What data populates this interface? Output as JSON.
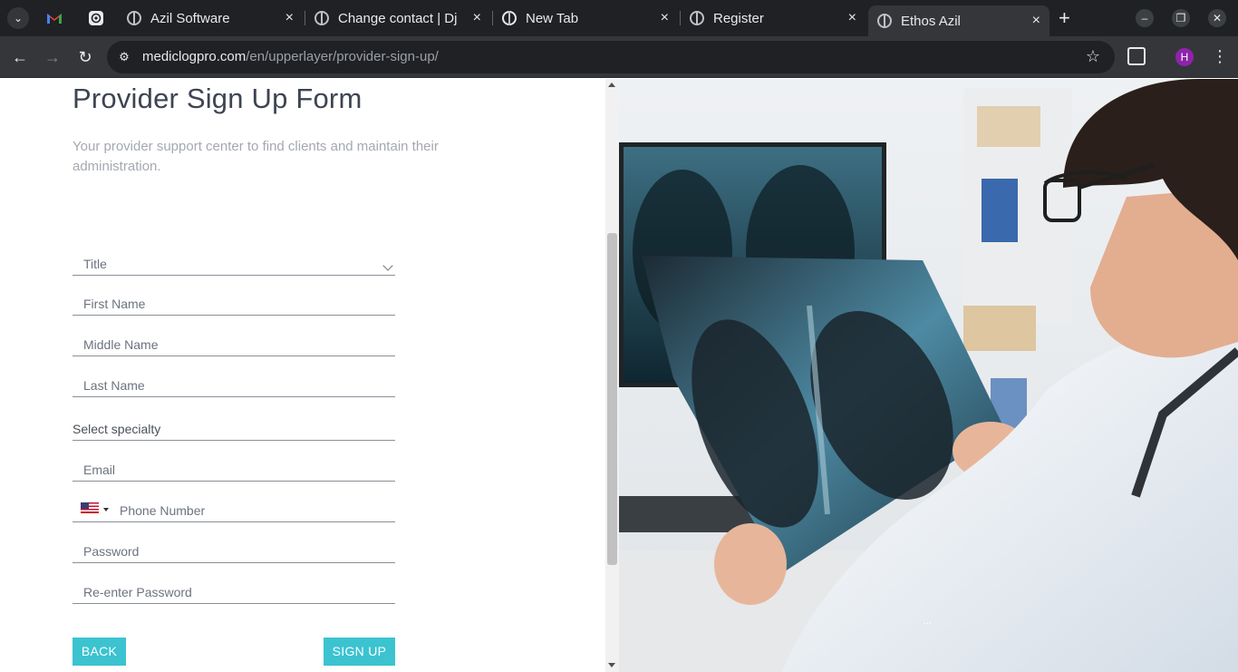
{
  "browser": {
    "tabs": [
      {
        "label": "Azil Software"
      },
      {
        "label": "Change contact | Dj"
      },
      {
        "label": "New Tab"
      },
      {
        "label": "Register"
      },
      {
        "label": "Ethos Azil",
        "active": true
      }
    ],
    "new_tab_symbol": "+",
    "close_symbol": "×",
    "url_host": "mediclogpro.com",
    "url_path": "/en/upperlayer/provider-sign-up/",
    "profile_initial": "H"
  },
  "form": {
    "title": "Provider Sign Up Form",
    "subtitle": "Your provider support center to find clients and maintain their administration.",
    "fields": {
      "title": "Title",
      "first_name": "First Name",
      "middle_name": "Middle Name",
      "last_name": "Last Name",
      "specialty": "Select specialty",
      "email": "Email",
      "phone": "Phone Number",
      "password": "Password",
      "reenter_password": "Re-enter Password"
    },
    "back_label": "BACK",
    "signup_label": "SIGN UP",
    "accent_color": "#3bc3d0"
  },
  "hero": {
    "image_subject": "doctor-viewing-chest-xray",
    "carousel_dots": "..."
  }
}
